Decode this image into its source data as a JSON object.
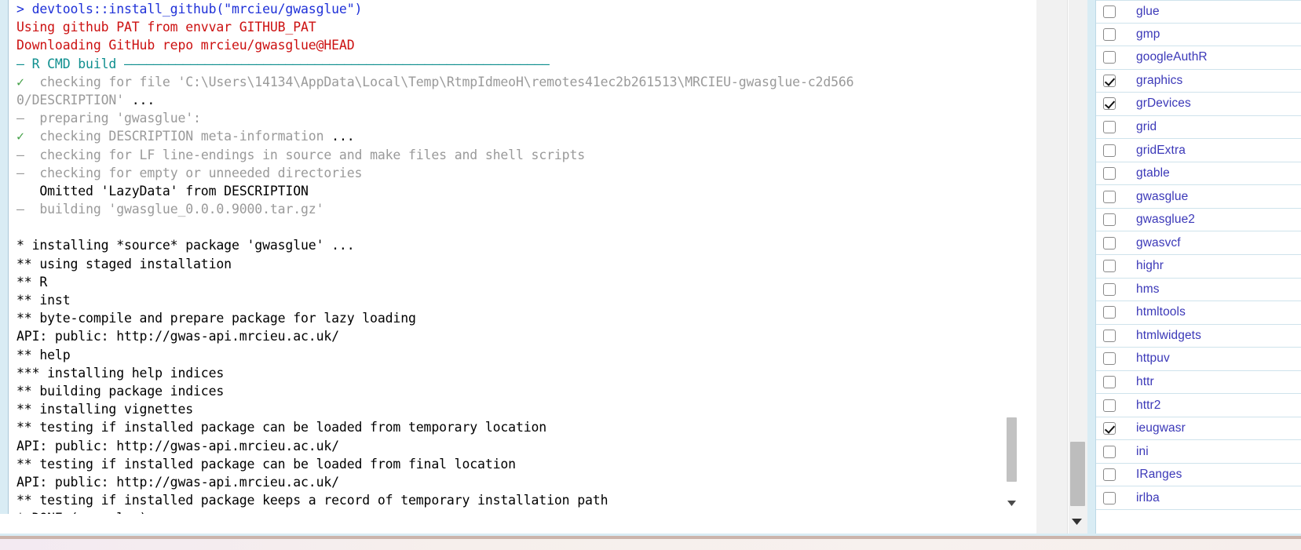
{
  "console": {
    "lines": [
      {
        "segments": [
          {
            "t": "> devtools::install_github(\"mrcieu/gwasglue\")",
            "c": "c-prompt"
          }
        ]
      },
      {
        "segments": [
          {
            "t": "Using github PAT from envvar GITHUB_PAT",
            "c": "c-error"
          }
        ]
      },
      {
        "segments": [
          {
            "t": "Downloading GitHub repo mrcieu/gwasglue@HEAD",
            "c": "c-error"
          }
        ]
      },
      {
        "segments": [
          {
            "t": "— R CMD build ",
            "c": "c-rule-lbl"
          },
          {
            "t": "——————————————————————————————————————————————————————————",
            "c": "rule-dashes"
          }
        ]
      },
      {
        "segments": [
          {
            "t": "✓",
            "c": "c-check"
          },
          {
            "t": "  checking for file 'C:\\Users\\14134\\AppData\\Local\\Temp\\RtmpIdmeoH\\remotes41ec2b261513\\MRCIEU-gwasglue-c2d566",
            "c": "c-muted"
          }
        ]
      },
      {
        "segments": [
          {
            "t": "0/DESCRIPTION' ",
            "c": "c-muted"
          },
          {
            "t": "...",
            "c": "c-black"
          }
        ]
      },
      {
        "segments": [
          {
            "t": "—",
            "c": "c-muted"
          },
          {
            "t": "  preparing 'gwasglue':",
            "c": "c-muted"
          }
        ]
      },
      {
        "segments": [
          {
            "t": "✓",
            "c": "c-check"
          },
          {
            "t": "  checking DESCRIPTION meta-information ",
            "c": "c-muted"
          },
          {
            "t": "...",
            "c": "c-black"
          }
        ]
      },
      {
        "segments": [
          {
            "t": "—",
            "c": "c-muted"
          },
          {
            "t": "  checking for LF line-endings in source and make files and shell scripts",
            "c": "c-muted"
          }
        ]
      },
      {
        "segments": [
          {
            "t": "—",
            "c": "c-muted"
          },
          {
            "t": "  checking for empty or unneeded directories",
            "c": "c-muted"
          }
        ]
      },
      {
        "segments": [
          {
            "t": "   Omitted 'LazyData' from DESCRIPTION",
            "c": "c-black"
          }
        ]
      },
      {
        "segments": [
          {
            "t": "—",
            "c": "c-muted"
          },
          {
            "t": "  building 'gwasglue_0.0.0.9000.tar.gz'",
            "c": "c-muted"
          }
        ]
      },
      {
        "segments": [
          {
            "t": "",
            "c": "c-black"
          }
        ]
      },
      {
        "segments": [
          {
            "t": "* installing *source* package 'gwasglue' ...",
            "c": "c-black"
          }
        ]
      },
      {
        "segments": [
          {
            "t": "** using staged installation",
            "c": "c-black"
          }
        ]
      },
      {
        "segments": [
          {
            "t": "** R",
            "c": "c-black"
          }
        ]
      },
      {
        "segments": [
          {
            "t": "** inst",
            "c": "c-black"
          }
        ]
      },
      {
        "segments": [
          {
            "t": "** byte-compile and prepare package for lazy loading",
            "c": "c-black"
          }
        ]
      },
      {
        "segments": [
          {
            "t": "API: public: http://gwas-api.mrcieu.ac.uk/",
            "c": "c-black"
          }
        ]
      },
      {
        "segments": [
          {
            "t": "** help",
            "c": "c-black"
          }
        ]
      },
      {
        "segments": [
          {
            "t": "*** installing help indices",
            "c": "c-black"
          }
        ]
      },
      {
        "segments": [
          {
            "t": "** building package indices",
            "c": "c-black"
          }
        ]
      },
      {
        "segments": [
          {
            "t": "** installing vignettes",
            "c": "c-black"
          }
        ]
      },
      {
        "segments": [
          {
            "t": "** testing if installed package can be loaded from temporary location",
            "c": "c-black"
          }
        ]
      },
      {
        "segments": [
          {
            "t": "API: public: http://gwas-api.mrcieu.ac.uk/",
            "c": "c-black"
          }
        ]
      },
      {
        "segments": [
          {
            "t": "** testing if installed package can be loaded from final location",
            "c": "c-black"
          }
        ]
      },
      {
        "segments": [
          {
            "t": "API: public: http://gwas-api.mrcieu.ac.uk/",
            "c": "c-black"
          }
        ]
      },
      {
        "segments": [
          {
            "t": "** testing if installed package keeps a record of temporary installation path",
            "c": "c-black"
          }
        ]
      },
      {
        "segments": [
          {
            "t": "* DONE (gwasglue)",
            "c": "c-black"
          }
        ]
      }
    ]
  },
  "packages": {
    "items": [
      {
        "name": "glue",
        "checked": false
      },
      {
        "name": "gmp",
        "checked": false
      },
      {
        "name": "googleAuthR",
        "checked": false
      },
      {
        "name": "graphics",
        "checked": true
      },
      {
        "name": "grDevices",
        "checked": true
      },
      {
        "name": "grid",
        "checked": false
      },
      {
        "name": "gridExtra",
        "checked": false
      },
      {
        "name": "gtable",
        "checked": false
      },
      {
        "name": "gwasglue",
        "checked": false
      },
      {
        "name": "gwasglue2",
        "checked": false
      },
      {
        "name": "gwasvcf",
        "checked": false
      },
      {
        "name": "highr",
        "checked": false
      },
      {
        "name": "hms",
        "checked": false
      },
      {
        "name": "htmltools",
        "checked": false
      },
      {
        "name": "htmlwidgets",
        "checked": false
      },
      {
        "name": "httpuv",
        "checked": false
      },
      {
        "name": "httr",
        "checked": false
      },
      {
        "name": "httr2",
        "checked": false
      },
      {
        "name": "ieugwasr",
        "checked": true
      },
      {
        "name": "ini",
        "checked": false
      },
      {
        "name": "IRanges",
        "checked": false
      },
      {
        "name": "irlba",
        "checked": false
      }
    ]
  },
  "colors": {
    "prompt_blue": "#1f31d8",
    "error_red": "#cc1111",
    "rule_teal": "#0f8f8f",
    "muted_grey": "#9a9a9a",
    "check_green": "#43a047",
    "package_link": "#3b38b8",
    "pane_edge": "#d9ecf4"
  }
}
